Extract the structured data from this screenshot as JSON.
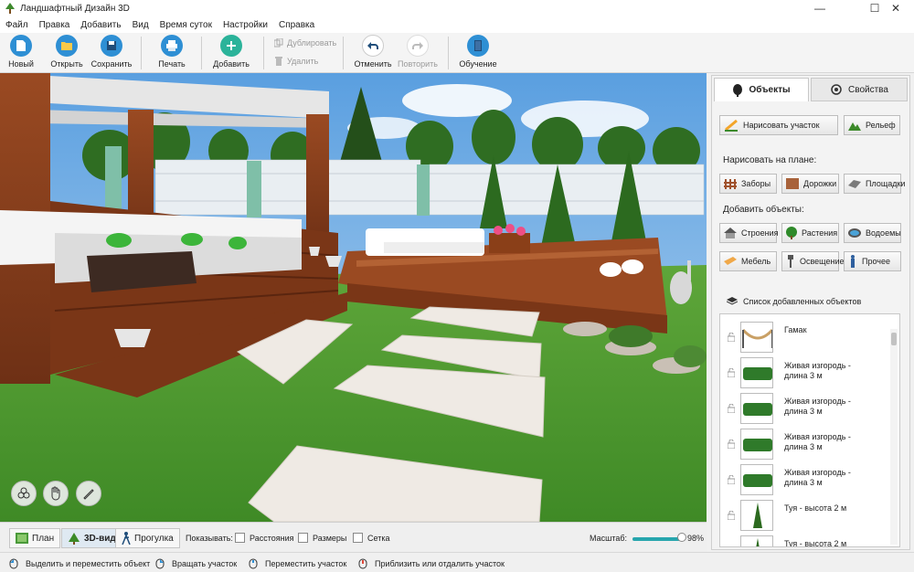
{
  "window": {
    "title": "Ландшафтный Дизайн 3D"
  },
  "menu": [
    "Файл",
    "Правка",
    "Добавить",
    "Вид",
    "Время суток",
    "Настройки",
    "Справка"
  ],
  "toolbar": {
    "new": "Новый",
    "open": "Открыть",
    "save": "Сохранить",
    "print": "Печать",
    "add": "Добавить",
    "duplicate": "Дублировать",
    "delete": "Удалить",
    "undo": "Отменить",
    "redo": "Повторить",
    "learn": "Обучение"
  },
  "viewbar": {
    "tab_plan": "План",
    "tab_3d": "3D-вид",
    "tab_walk": "Прогулка",
    "show_label": "Показывать:",
    "chk_distances": "Расстояния",
    "chk_sizes": "Размеры",
    "chk_grid": "Сетка",
    "zoom_label": "Масштаб:",
    "zoom_value": "98%",
    "zoom_fraction": 0.98
  },
  "status": {
    "hint1": "Выделить и переместить объект",
    "hint2": "Вращать участок",
    "hint3": "Переместить участок",
    "hint4": "Приблизить или отдалить участок"
  },
  "panel": {
    "tab_objects": "Объекты",
    "tab_properties": "Свойства",
    "draw_area": "Нарисовать участок",
    "relief": "Рельеф",
    "draw_on_plan": "Нарисовать на плане:",
    "fences": "Заборы",
    "paths": "Дорожки",
    "platforms": "Площадки",
    "add_objects": "Добавить объекты:",
    "buildings": "Строения",
    "plants": "Растения",
    "ponds": "Водоемы",
    "furniture": "Мебель",
    "lighting": "Освещение",
    "other": "Прочее",
    "list_title": "Список добавленных объектов",
    "items": [
      {
        "name": "Гамак"
      },
      {
        "name": "Живая изгородь - длина 3 м"
      },
      {
        "name": "Живая изгородь - длина 3 м"
      },
      {
        "name": "Живая изгородь - длина 3 м"
      },
      {
        "name": "Живая изгородь - длина 3 м"
      },
      {
        "name": "Туя - высота 2 м"
      },
      {
        "name": "Туя - высота 2 м"
      }
    ]
  },
  "colors": {
    "accent": "#27a6ad",
    "toolbar_blue": "#2e8fd4",
    "add_green": "#2bb39a"
  }
}
